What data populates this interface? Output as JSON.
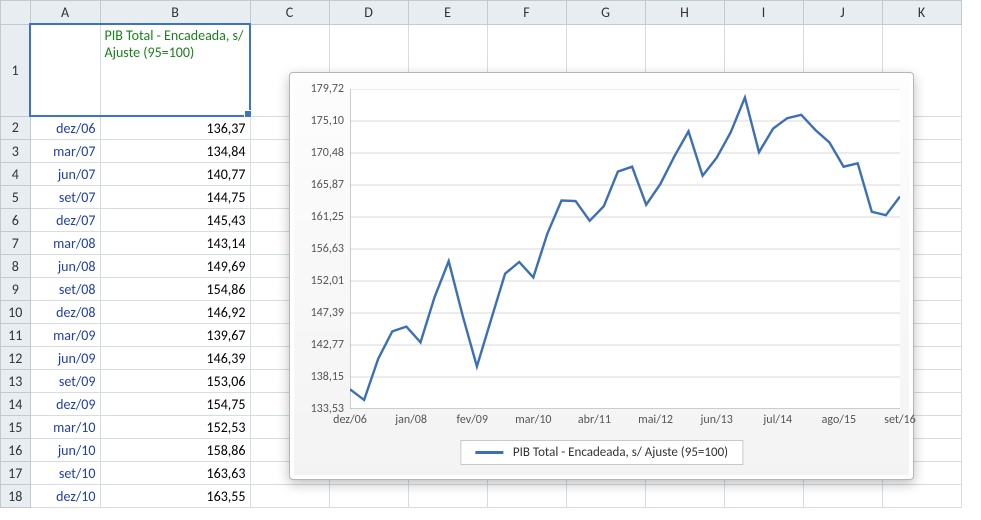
{
  "columns": [
    "A",
    "B",
    "C",
    "D",
    "E",
    "F",
    "G",
    "H",
    "I",
    "J",
    "K"
  ],
  "row_numbers": [
    1,
    2,
    3,
    4,
    5,
    6,
    7,
    8,
    9,
    10,
    11,
    12,
    13,
    14,
    15,
    16,
    17,
    18
  ],
  "header_B": "PIB Total - Encadeada, s/ Ajuste (95=100)",
  "rows": [
    {
      "date": "dez/06",
      "value": "136,37"
    },
    {
      "date": "mar/07",
      "value": "134,84"
    },
    {
      "date": "jun/07",
      "value": "140,77"
    },
    {
      "date": "set/07",
      "value": "144,75"
    },
    {
      "date": "dez/07",
      "value": "145,43"
    },
    {
      "date": "mar/08",
      "value": "143,14"
    },
    {
      "date": "jun/08",
      "value": "149,69"
    },
    {
      "date": "set/08",
      "value": "154,86"
    },
    {
      "date": "dez/08",
      "value": "146,92"
    },
    {
      "date": "mar/09",
      "value": "139,67"
    },
    {
      "date": "jun/09",
      "value": "146,39"
    },
    {
      "date": "set/09",
      "value": "153,06"
    },
    {
      "date": "dez/09",
      "value": "154,75"
    },
    {
      "date": "mar/10",
      "value": "152,53"
    },
    {
      "date": "jun/10",
      "value": "158,86"
    },
    {
      "date": "set/10",
      "value": "163,63"
    },
    {
      "date": "dez/10",
      "value": "163,55"
    }
  ],
  "chart_data": {
    "type": "line",
    "title": "",
    "legend": "PIB Total - Encadeada, s/ Ajuste (95=100)",
    "ylim": [
      133.53,
      179.72
    ],
    "yticks": [
      "133,53",
      "138,15",
      "142,77",
      "147,39",
      "152,01",
      "156,63",
      "161,25",
      "165,87",
      "170,48",
      "175,10",
      "179,72"
    ],
    "x_categories": [
      "dez/06",
      "jan/08",
      "fev/09",
      "mar/10",
      "abr/11",
      "mai/12",
      "jun/13",
      "jul/14",
      "ago/15",
      "set/16"
    ],
    "series": [
      {
        "name": "PIB Total - Encadeada, s/ Ajuste (95=100)",
        "color": "#3b6fb6",
        "values": [
          136.37,
          134.84,
          140.77,
          144.75,
          145.43,
          143.14,
          149.69,
          154.86,
          146.92,
          139.67,
          146.39,
          153.06,
          154.75,
          152.53,
          158.86,
          163.63,
          163.55,
          160.7,
          162.8,
          167.8,
          168.5,
          163.0,
          166.0,
          170.0,
          173.6,
          167.2,
          169.8,
          173.5,
          178.5,
          170.6,
          174.0,
          175.5,
          176.0,
          173.8,
          172.0,
          168.5,
          169.0,
          162.0,
          161.5,
          164.2
        ]
      }
    ]
  }
}
